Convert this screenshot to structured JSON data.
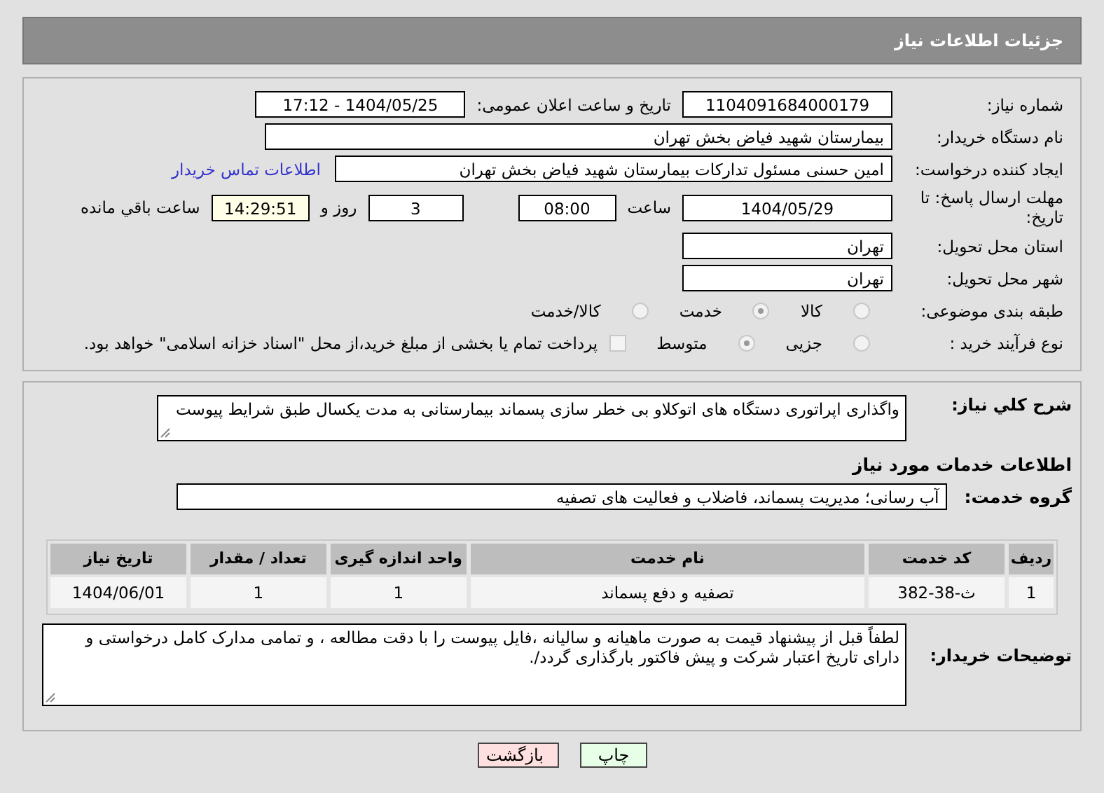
{
  "header": {
    "title": "جزئیات اطلاعات نیاز"
  },
  "need_number": {
    "label": "شماره نیاز:",
    "value": "1104091684000179"
  },
  "announce": {
    "label": "تاریخ و ساعت اعلان عمومی:",
    "value": "1404/05/25 - 17:12"
  },
  "buyer_org": {
    "label": "نام دستگاه خریدار:",
    "value": "بیمارستان شهید فیاض بخش تهران"
  },
  "creator": {
    "label": "ایجاد کننده درخواست:",
    "value": "امین حسنی مسئول تدارکات بیمارستان شهید فیاض بخش تهران",
    "link": "اطلاعات تماس خریدار"
  },
  "deadline": {
    "label": "مهلت ارسال پاسخ: تا تاریخ:",
    "date": "1404/05/29",
    "time_label": "ساعت",
    "time": "08:00",
    "days": "3",
    "days_label": "روز و",
    "remaining": "14:29:51",
    "remaining_label": "ساعت باقي مانده"
  },
  "province": {
    "label": "استان محل تحویل:",
    "value": "تهران"
  },
  "city": {
    "label": "شهر محل تحویل:",
    "value": "تهران"
  },
  "category": {
    "label": "طبقه بندی موضوعی:",
    "options": [
      {
        "label": "کالا",
        "selected": false
      },
      {
        "label": "خدمت",
        "selected": true
      },
      {
        "label": "کالا/خدمت",
        "selected": false
      }
    ]
  },
  "process": {
    "label": "نوع فرآیند خرید :",
    "options": [
      {
        "label": "جزیی",
        "selected": false
      },
      {
        "label": "متوسط",
        "selected": true
      }
    ],
    "treasury": {
      "checked": false,
      "label": "پرداخت تمام یا بخشی از مبلغ خرید،از محل \"اسناد خزانه اسلامی\" خواهد بود."
    }
  },
  "description": {
    "label": "شرح کلي نیاز:",
    "value": "واگذاری اپراتوری دستگاه های اتوکلاو  بی خطر سازی پسماند بیمارستانی به مدت یکسال  طبق شرایط پیوست"
  },
  "services_heading": "اطلاعات خدمات مورد نیاز",
  "service_group": {
    "label": "گروه خدمت:",
    "value": "آب رسانی؛ مدیریت پسماند، فاضلاب و فعالیت های تصفیه"
  },
  "table": {
    "columns": [
      "ردیف",
      "کد خدمت",
      "نام خدمت",
      "واحد اندازه گیری",
      "تعداد / مقدار",
      "تاریخ نیاز"
    ],
    "rows": [
      [
        "1",
        "ث-38-382",
        "تصفیه و دفع پسماند",
        "1",
        "1",
        "1404/06/01"
      ]
    ]
  },
  "buyer_notes": {
    "label": "توضیحات خریدار:",
    "value": "لطفاً قبل از پیشنهاد قیمت به صورت ماهیانه و سالیانه ،فایل پیوست را با دقت مطالعه ، و تمامی مدارک  کامل درخواستی  و دارای تاریخ  اعتبار شرکت و پیش فاکتور  بارگذاری گردد/."
  },
  "buttons": [
    {
      "kind": "print",
      "label": "چاپ"
    },
    {
      "kind": "back",
      "label": "بازگشت"
    }
  ]
}
